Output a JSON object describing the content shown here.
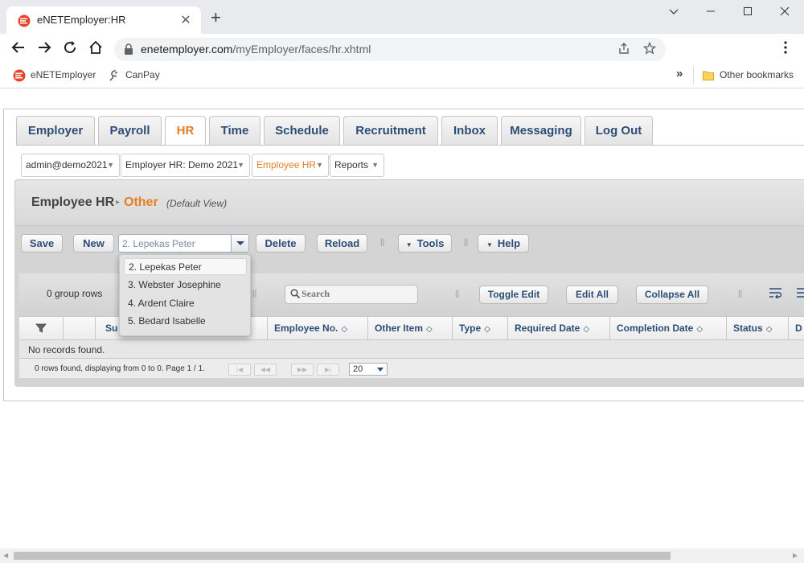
{
  "browser": {
    "tab_title": "eNETEmployer:HR",
    "tab_close": "✕",
    "new_tab": "+",
    "window_controls": {
      "minimize": "—",
      "maximize": "☐",
      "close": "✕"
    },
    "url_host": "enetemployer.com",
    "url_path": "/myEmployer/faces/hr.xhtml",
    "bookmarks": [
      {
        "label": "eNETEmployer",
        "icon": "enet-logo-icon"
      },
      {
        "label": "CanPay",
        "icon": "canpay-logo-icon"
      }
    ],
    "bookmarks_overflow": "»",
    "other_bookmarks": "Other bookmarks",
    "colors": {
      "brand_accent": "#e8432b"
    }
  },
  "main_tabs": [
    {
      "label": "Employer"
    },
    {
      "label": "Payroll"
    },
    {
      "label": "HR",
      "active": true
    },
    {
      "label": "Time"
    },
    {
      "label": "Schedule"
    },
    {
      "label": "Recruitment"
    },
    {
      "label": "Inbox"
    },
    {
      "label": "Messaging"
    },
    {
      "label": "Log Out"
    }
  ],
  "sub_menus": {
    "user": "admin@demo2021",
    "employer": "Employer HR: Demo 2021",
    "section": "Employee HR",
    "reports": "Reports"
  },
  "header": {
    "title": "Employee HR",
    "subtitle": "Other",
    "view": "(Default View)"
  },
  "actions": {
    "save": "Save",
    "new": "New",
    "employee_combo_value": "2. Lepekas Peter",
    "delete": "Delete",
    "reload": "Reload",
    "tools": "Tools",
    "help": "Help",
    "separator": "||"
  },
  "employee_dropdown": {
    "options": [
      "2. Lepekas Peter",
      "3. Webster Josephine",
      "4. Ardent Claire",
      "5. Bedard Isabelle"
    ],
    "selected_index": 0
  },
  "grid": {
    "group_rows": "0 group rows",
    "search_placeholder": "Search",
    "toggle_edit": "Toggle Edit",
    "edit_all": "Edit All",
    "collapse_all": "Collapse All",
    "columns": [
      "Su",
      "Employee No.",
      "Other Item",
      "Type",
      "Required Date",
      "Completion Date",
      "Status",
      "D"
    ],
    "sort_glyph": "◇",
    "no_records": "No records found.",
    "pager_text": "0 rows found, displaying from 0 to 0. Page 1 / 1.",
    "page_size": "20"
  }
}
